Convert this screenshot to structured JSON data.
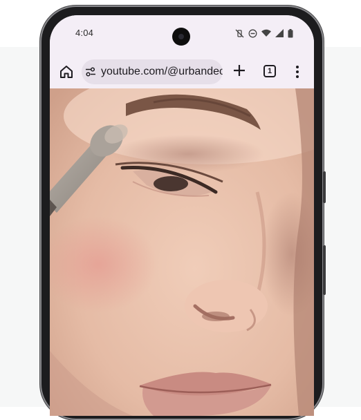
{
  "status_bar": {
    "time": "4:04",
    "icons": [
      "vibrate-off-icon",
      "do-not-disturb-icon",
      "wifi-icon",
      "cell-signal-icon",
      "battery-icon"
    ]
  },
  "toolbar": {
    "home_icon": "home-icon",
    "site_settings_icon": "tune-icon",
    "url": "youtube.com/@urbandeca",
    "new_tab_icon": "plus-icon",
    "tab_count": "1",
    "menu_icon": "more-vert-icon"
  },
  "content": {
    "type": "video-frame",
    "description_icon": "video-frame"
  },
  "colors": {
    "surface": "#f4eef6",
    "url_pill": "#e6dfe9",
    "text": "#1d1b20",
    "skin": "#e8c2ae",
    "lips": "#c98b82"
  }
}
